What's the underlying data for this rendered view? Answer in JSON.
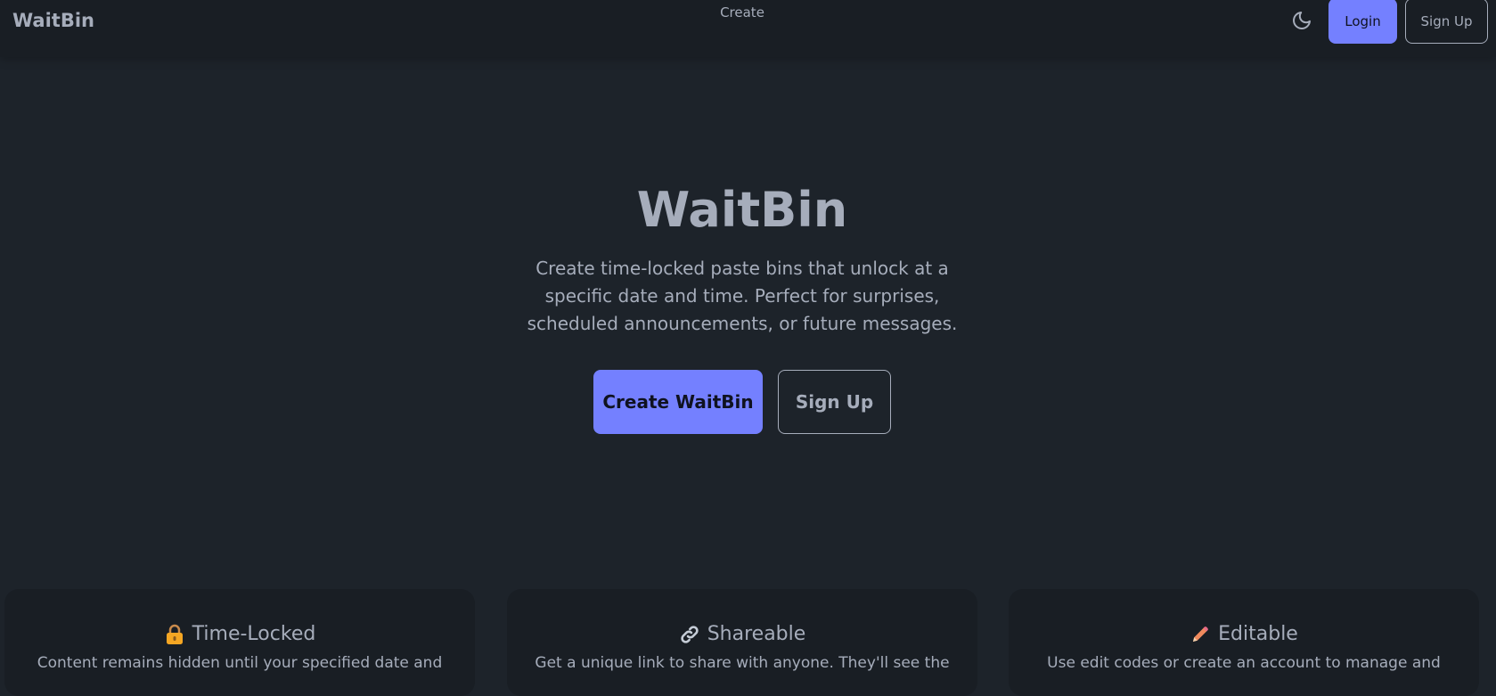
{
  "navbar": {
    "brand": "WaitBin",
    "center_link": "Create",
    "theme_icon": "moon-icon",
    "login_label": "Login",
    "signup_label": "Sign Up"
  },
  "hero": {
    "title": "WaitBin",
    "description": "Create time-locked paste bins that unlock at a specific date and time. Perfect for surprises, scheduled announcements, or future messages.",
    "create_label": "Create WaitBin",
    "signup_label": "Sign Up"
  },
  "features": [
    {
      "icon": "lock-icon",
      "title": "Time-Locked",
      "text": "Content remains hidden until your specified date and"
    },
    {
      "icon": "link-icon",
      "title": "Shareable",
      "text": "Get a unique link to share with anyone. They'll see the"
    },
    {
      "icon": "pencil-icon",
      "title": "Editable",
      "text": "Use edit codes or create an account to manage and"
    }
  ],
  "colors": {
    "background": "#1d232a",
    "navbar": "#191e24",
    "primary": "#7480ff",
    "text": "#a6adbb"
  }
}
